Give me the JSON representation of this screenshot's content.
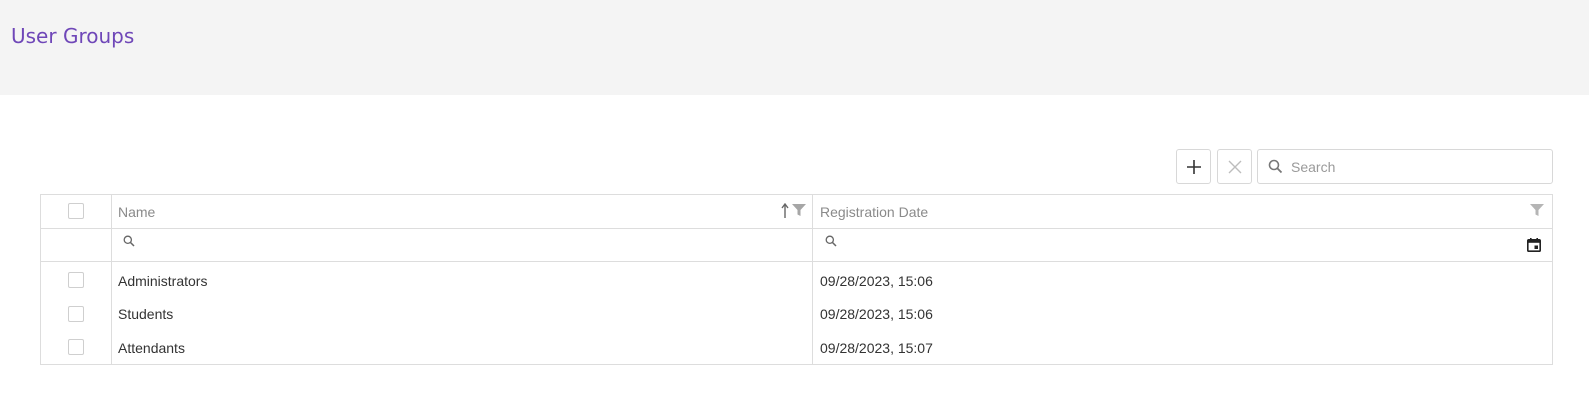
{
  "page": {
    "title": "User Groups"
  },
  "toolbar": {
    "add_icon": "plus-icon",
    "delete_icon": "close-icon",
    "search_placeholder": "Search",
    "search_value": ""
  },
  "grid": {
    "columns": [
      {
        "key": "select",
        "label": ""
      },
      {
        "key": "name",
        "label": "Name",
        "icons": [
          "sort-ascending-icon",
          "filter-icon"
        ]
      },
      {
        "key": "registration_date",
        "label": "Registration Date",
        "icons": [
          "filter-icon"
        ]
      }
    ],
    "filter_row": {
      "name_icon": "search-icon",
      "date_icon": "search-icon",
      "date_picker_icon": "calendar-icon"
    },
    "rows": [
      {
        "name": "Administrators",
        "registration_date": "09/28/2023, 15:06"
      },
      {
        "name": "Students",
        "registration_date": "09/28/2023, 15:06"
      },
      {
        "name": "Attendants",
        "registration_date": "09/28/2023, 15:07"
      }
    ]
  },
  "colors": {
    "accent": "#6f47b8",
    "header_bg": "#f4f4f4",
    "border": "#dddddd"
  }
}
